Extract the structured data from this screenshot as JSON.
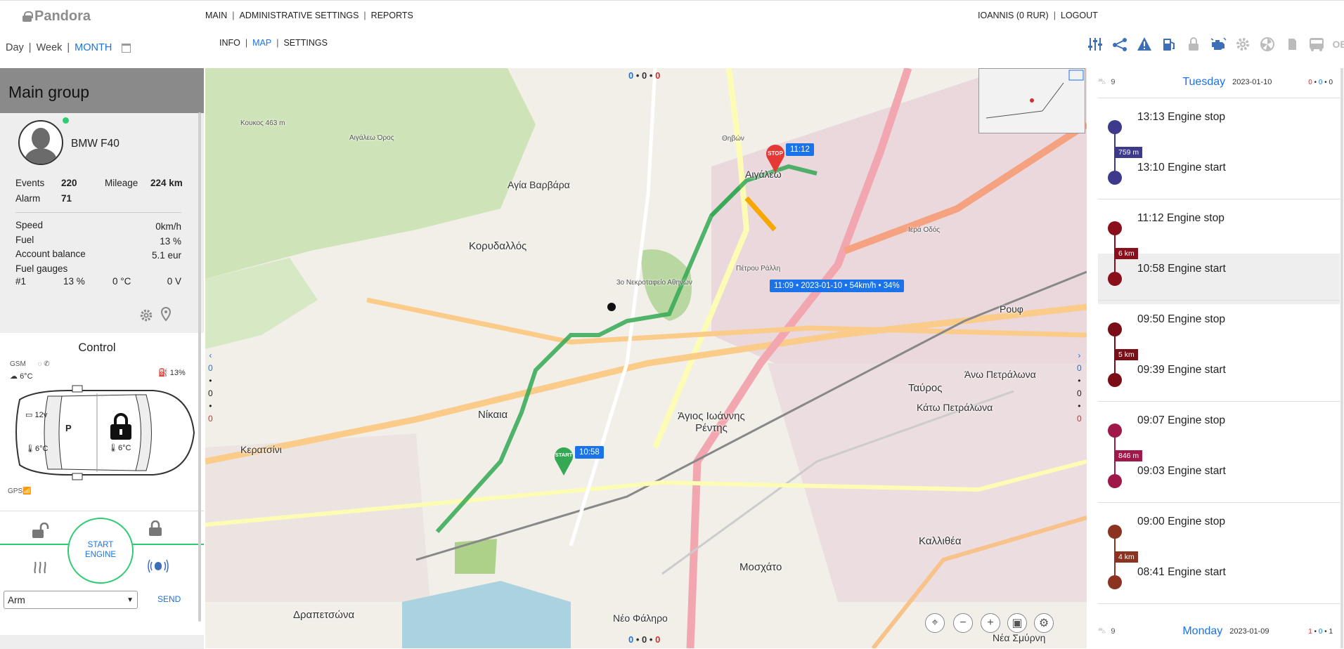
{
  "header": {
    "logo": "Pandora",
    "nav": [
      "MAIN",
      "ADMINISTRATIVE SETTINGS",
      "REPORTS"
    ],
    "subnav": [
      "INFO",
      "MAP",
      "SETTINGS"
    ],
    "subnav_active": "MAP",
    "user": "IOANNIS (0 RUR)",
    "logout": "LOGOUT",
    "periods": [
      "Day",
      "Week",
      "MONTH"
    ],
    "period_active": "MONTH"
  },
  "toolbar": {
    "icons": [
      "sliders-icon",
      "route-icon",
      "warning-icon",
      "fuel-pump-icon",
      "lock-icon",
      "engine-icon",
      "gear-icon",
      "fan-icon",
      "phone-icon",
      "bus-icon"
    ],
    "obd_label": "OBD"
  },
  "sidebar": {
    "group_title": "Main group",
    "vehicle": {
      "name": "BMW F40",
      "online": true,
      "events_label": "Events",
      "events": "220",
      "mileage_label": "Mileage",
      "mileage": "224 km",
      "alarm_label": "Alarm",
      "alarm": "71",
      "speed_label": "Speed",
      "speed": "0km/h",
      "fuel_label": "Fuel",
      "fuel": "13 %",
      "balance_label": "Account balance",
      "balance": "5.1 eur",
      "gauges_label": "Fuel gauges",
      "gauge_id": "#1",
      "gauge_pct": "13 %",
      "gauge_temp": "0 °C",
      "gauge_volt": "0 V"
    },
    "control": {
      "title": "Control",
      "gsm": "GSM",
      "outside_temp": "6°C",
      "fuel_pct": "13%",
      "voltage": "12v",
      "engine_temp": "6°C",
      "cabin_temp": "6°C",
      "gear_text": "P",
      "gps": "GPS",
      "start_line1": "START",
      "start_line2": "ENGINE",
      "mode_value": "Arm",
      "send_label": "SEND"
    }
  },
  "map": {
    "top_counts": [
      "0",
      "0",
      "0"
    ],
    "bottom_counts": [
      "0",
      "0",
      "0"
    ],
    "side_counts": [
      "0",
      "•",
      "0",
      "•",
      "0"
    ],
    "stop_marker": "STOP",
    "start_marker": "START",
    "stop_time": "11:12",
    "start_time": "10:58",
    "track_tooltip": "11:09 • 2023-01-10 • 54km/h • 34%",
    "labels": [
      "Κορυδαλλός",
      "Νίκαια",
      "Άγιος Ιωάννης Ρέντης",
      "Ταύρος",
      "Μοσχάτο",
      "Καλλιθέα",
      "Δραπετσώνα",
      "Κερατσίνι",
      "Αιγάλεω",
      "Αγία Βαρβάρα",
      "Ρουφ",
      "Νέα Σμύρνη",
      "Κάτω Πετράλωνα",
      "Άνω Πετράλωνα",
      "Νέο Φάληρο"
    ],
    "label_small": [
      "Κουκος 463 m",
      "Αιγάλεω Όρος",
      "3ο Νεκροταφείο Αθηνών",
      "Πέτρου Ράλλη",
      "Ιερά Οδός",
      "Θηβών"
    ]
  },
  "journal": {
    "days": [
      {
        "count": "9",
        "name": "Tuesday",
        "date": "2023-01-10",
        "dots": [
          "0",
          "0",
          "0"
        ]
      },
      {
        "count": "9",
        "name": "Monday",
        "date": "2023-01-09",
        "dots": [
          "1",
          "0",
          "1"
        ]
      }
    ],
    "trips": [
      {
        "stop": "13:13",
        "stop_label": "Engine stop",
        "dist": "759 m",
        "start": "13:10",
        "start_label": "Engine start",
        "color": "#3d3a8c"
      },
      {
        "stop": "11:12",
        "stop_label": "Engine stop",
        "dist": "6 km",
        "start": "10:58",
        "start_label": "Engine start",
        "color": "#8b0f1a",
        "selected": true
      },
      {
        "stop": "09:50",
        "stop_label": "Engine stop",
        "dist": "5 km",
        "start": "09:39",
        "start_label": "Engine start",
        "color": "#7a0d16"
      },
      {
        "stop": "09:07",
        "stop_label": "Engine stop",
        "dist": "846 m",
        "start": "09:03",
        "start_label": "Engine start",
        "color": "#a0184a"
      },
      {
        "stop": "09:00",
        "stop_label": "Engine stop",
        "dist": "4 km",
        "start": "08:41",
        "start_label": "Engine start",
        "color": "#8b3320"
      }
    ]
  }
}
